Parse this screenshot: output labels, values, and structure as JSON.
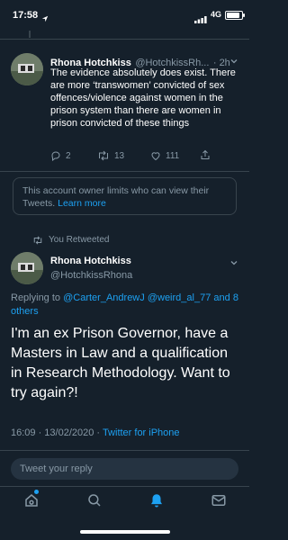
{
  "status_bar": {
    "time": "17:58",
    "network": "4G",
    "battery_level": 0.85
  },
  "previous_tweet": {
    "name": "Rhona Hotchkiss",
    "handle": "@HotchkissRh...",
    "age": "· 2h",
    "text": "The evidence absolutely does exist. There are more ‘transwomen’ convicted of sex offences/violence against women in the prison system than there are women in prison convicted of these things",
    "replies": "2",
    "retweets": "13",
    "likes": "111"
  },
  "notice": {
    "text": "This account owner limits who can view their Tweets.",
    "link": "Learn more"
  },
  "retweet_context": "You Retweeted",
  "main_tweet": {
    "name": "Rhona Hotchkiss",
    "handle": "@HotchkissRhona",
    "replying_prefix": "Replying to",
    "mention_1": "@Carter_AndrewJ",
    "mention_2": "@weird_al_77",
    "and_text": "and",
    "others_link": "8 others",
    "text": "I'm an ex Prison Governor, have a Masters in Law and a qualification in Research Methodology. Want to try again?!",
    "timestamp": "16:09 · 13/02/2020 ·",
    "source": "Twitter for iPhone"
  },
  "reply": {
    "placeholder": "Tweet your reply"
  },
  "colors": {
    "background": "#15202b",
    "accent": "#1da1f2",
    "secondary_text": "#8899a6",
    "divider": "#38444d"
  },
  "tab_bar": {
    "items": [
      "home-icon",
      "search-icon",
      "notifications-icon",
      "messages-icon"
    ],
    "active": "notifications-icon"
  }
}
